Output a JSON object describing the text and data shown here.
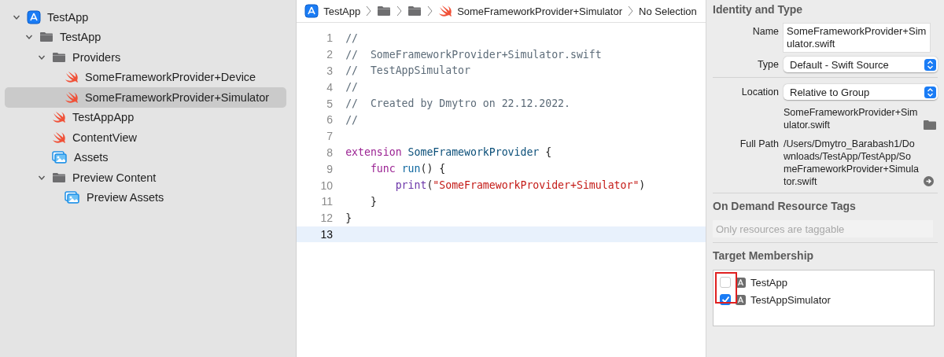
{
  "navigator": {
    "items": [
      {
        "kind": "app",
        "label": "TestApp",
        "expanded": true,
        "selected": false,
        "children": [
          {
            "kind": "folder",
            "label": "TestApp",
            "expanded": true,
            "selected": false,
            "children": [
              {
                "kind": "folder",
                "label": "Providers",
                "expanded": true,
                "selected": false,
                "children": [
                  {
                    "kind": "swift",
                    "label": "SomeFrameworkProvider+Device",
                    "selected": false
                  },
                  {
                    "kind": "swift",
                    "label": "SomeFrameworkProvider+Simulator",
                    "selected": true
                  }
                ]
              },
              {
                "kind": "swift",
                "label": "TestAppApp",
                "selected": false
              },
              {
                "kind": "swift",
                "label": "ContentView",
                "selected": false
              },
              {
                "kind": "assets",
                "label": "Assets",
                "selected": false
              },
              {
                "kind": "folder",
                "label": "Preview Content",
                "expanded": true,
                "selected": false,
                "children": [
                  {
                    "kind": "assets",
                    "label": "Preview Assets",
                    "selected": false
                  }
                ]
              }
            ]
          }
        ]
      }
    ]
  },
  "breadcrumb": [
    {
      "kind": "app",
      "label": "TestApp"
    },
    {
      "kind": "folder"
    },
    {
      "kind": "folder"
    },
    {
      "kind": "swift",
      "label": "SomeFrameworkProvider+Simulator"
    },
    {
      "kind": "text",
      "label": "No Selection"
    }
  ],
  "editor": {
    "lines": [
      {
        "number": "1",
        "current": false,
        "tokens": [
          {
            "kind": "comment",
            "text": "//"
          }
        ]
      },
      {
        "number": "2",
        "current": false,
        "tokens": [
          {
            "kind": "comment",
            "text": "//  SomeFrameworkProvider+Simulator.swift"
          }
        ]
      },
      {
        "number": "3",
        "current": false,
        "tokens": [
          {
            "kind": "comment",
            "text": "//  TestAppSimulator"
          }
        ]
      },
      {
        "number": "4",
        "current": false,
        "tokens": [
          {
            "kind": "comment",
            "text": "//"
          }
        ]
      },
      {
        "number": "5",
        "current": false,
        "tokens": [
          {
            "kind": "comment",
            "text": "//  Created by Dmytro on 22.12.2022."
          }
        ]
      },
      {
        "number": "6",
        "current": false,
        "tokens": [
          {
            "kind": "comment",
            "text": "//"
          }
        ]
      },
      {
        "number": "7",
        "current": false
      },
      {
        "number": "8",
        "current": false,
        "tokens": [
          {
            "kind": "keyword",
            "text": "extension "
          },
          {
            "kind": "type",
            "text": "SomeFrameworkProvider"
          },
          {
            "kind": "plain",
            "text": " {"
          }
        ]
      },
      {
        "number": "9",
        "current": false,
        "tokens": [
          {
            "kind": "keyword",
            "text": "    func "
          },
          {
            "kind": "decl",
            "text": "run"
          },
          {
            "kind": "plain",
            "text": "() {"
          }
        ]
      },
      {
        "number": "10",
        "current": false,
        "tokens": [
          {
            "kind": "call",
            "text": "        print"
          },
          {
            "kind": "plain",
            "text": "("
          },
          {
            "kind": "string",
            "text": "\"SomeFrameworkProvider+Simulator\""
          },
          {
            "kind": "plain",
            "text": ")"
          }
        ]
      },
      {
        "number": "11",
        "current": false,
        "tokens": [
          {
            "kind": "plain",
            "text": "    }"
          }
        ]
      },
      {
        "number": "12",
        "current": false,
        "tokens": [
          {
            "kind": "plain",
            "text": "}"
          }
        ]
      },
      {
        "number": "13",
        "current": true
      }
    ]
  },
  "inspector": {
    "identity": {
      "title": "Identity and Type",
      "name_label": "Name",
      "name_value": "SomeFrameworkProvider+Simulator.swift",
      "type_label": "Type",
      "type_value": "Default - Swift Source",
      "location_label": "Location",
      "location_value": "Relative to Group",
      "location_path": "SomeFrameworkProvider+Simulator.swift",
      "full_path_label": "Full Path",
      "full_path": "/Users/Dmytro_Barabash1/Downloads/TestApp/TestApp/SomeFrameworkProvider+Simulator.swift"
    },
    "tags": {
      "title": "On Demand Resource Tags",
      "placeholder": "Only resources are taggable"
    },
    "membership": {
      "title": "Target Membership",
      "checkbox_highlight": true,
      "targets": [
        {
          "label": "TestApp",
          "checked": false
        },
        {
          "label": "TestAppSimulator",
          "checked": true
        }
      ]
    }
  }
}
